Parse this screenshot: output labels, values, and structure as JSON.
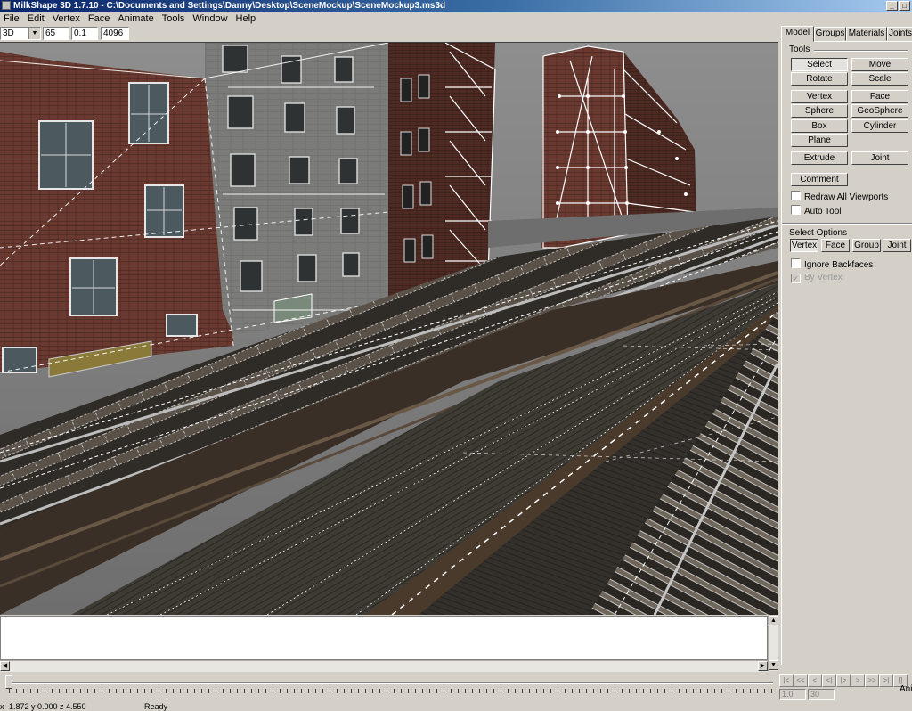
{
  "window": {
    "title": "MilkShape 3D 1.7.10 - C:\\Documents and Settings\\Danny\\Desktop\\SceneMockup\\SceneMockup3.ms3d"
  },
  "menu": [
    "File",
    "Edit",
    "Vertex",
    "Face",
    "Animate",
    "Tools",
    "Window",
    "Help"
  ],
  "toolbar": {
    "view_mode": "3D",
    "fov": "65",
    "near": "0.1",
    "far": "4096"
  },
  "panel": {
    "tabs": [
      "Model",
      "Groups",
      "Materials",
      "Joints"
    ],
    "active_tab": "Model",
    "tools_label": "Tools",
    "tools": [
      "Select",
      "Move",
      "Rotate",
      "Scale",
      "Vertex",
      "Face",
      "Sphere",
      "GeoSphere",
      "Box",
      "Cylinder",
      "Plane",
      "Extrude",
      "Joint",
      "Comment"
    ],
    "active_tool": "Select",
    "redraw_all_viewports": "Redraw All Viewports",
    "auto_tool": "Auto Tool",
    "select_options_label": "Select Options",
    "select_modes": [
      "Vertex",
      "Face",
      "Group",
      "Joint"
    ],
    "active_select_mode": "Vertex",
    "ignore_backfaces": "Ignore Backfaces",
    "by_vertex": "By Vertex"
  },
  "animation": {
    "frame": "1.0",
    "frame_count": "30",
    "anim_label": "Ani",
    "transport": [
      "|<",
      "<<",
      "<",
      "<|",
      "|>",
      ">",
      ">>",
      ">|",
      "[]"
    ]
  },
  "status": {
    "coords": "x -1.872 y 0.000 z 4.550",
    "message": "Ready"
  }
}
